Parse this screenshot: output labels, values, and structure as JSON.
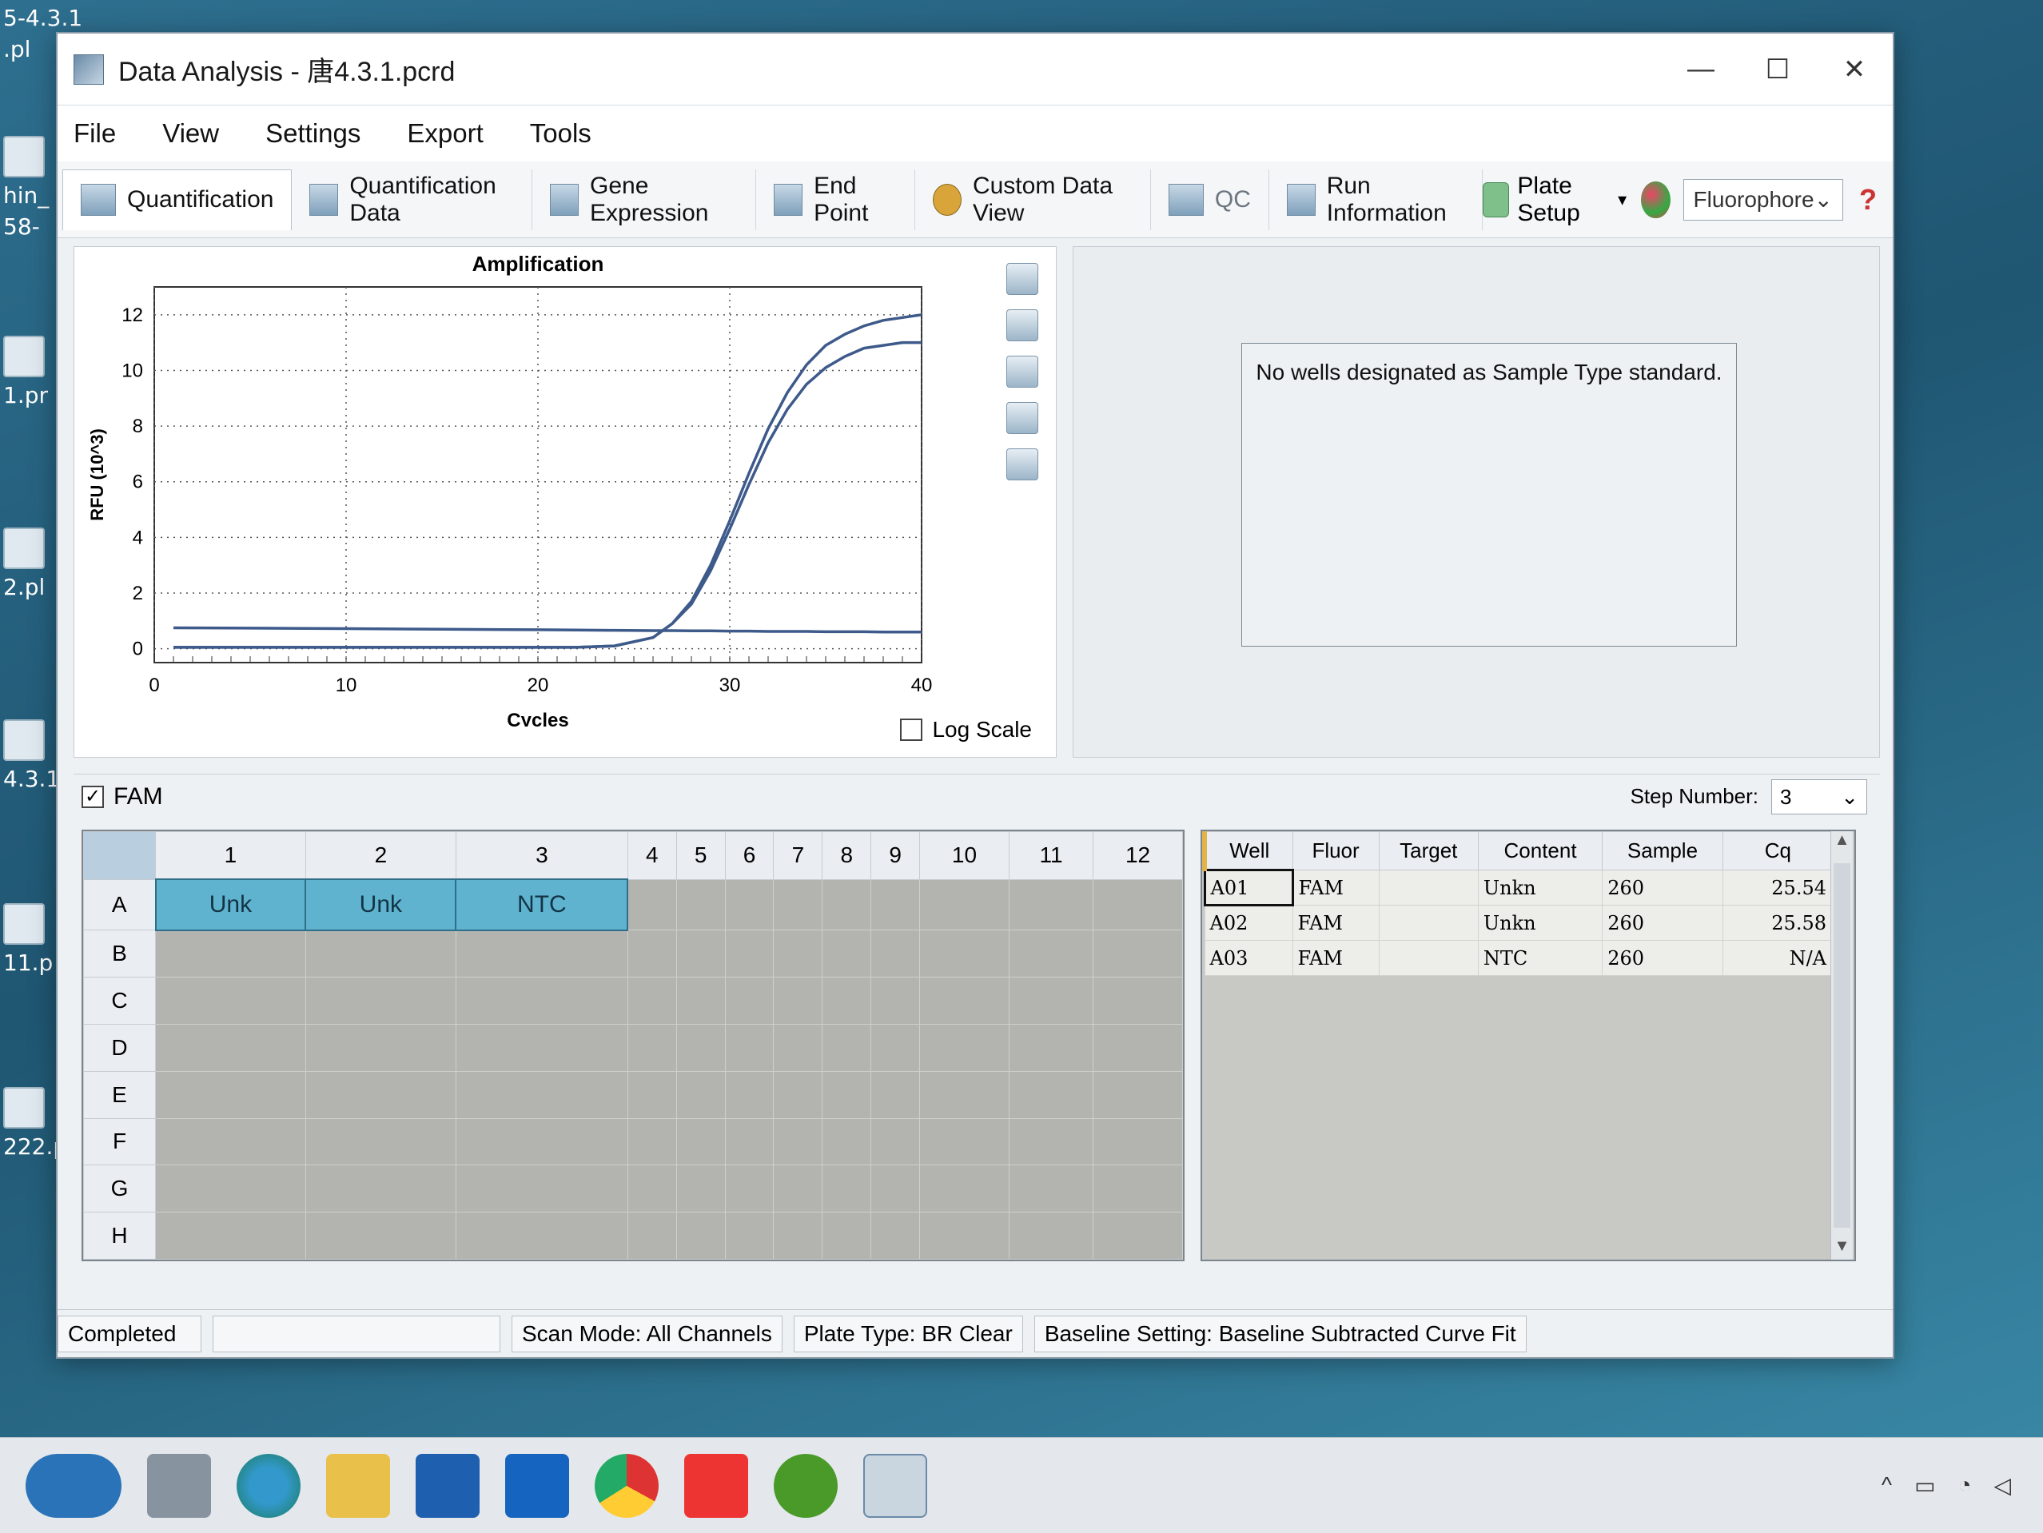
{
  "window": {
    "title": "Data Analysis - 唐4.3.1.pcrd",
    "controls": [
      "—",
      "☐",
      "✕"
    ]
  },
  "desktop_icons": [
    {
      "label": "5-4.3.1"
    },
    {
      "label": ".pl"
    },
    {
      "label": "hin_"
    },
    {
      "label": "58-"
    },
    {
      "label": "1.pr"
    },
    {
      "label": "2.pl"
    },
    {
      "label": "4.3.1"
    },
    {
      "label": "11.p"
    },
    {
      "label": "222.p"
    }
  ],
  "menu": [
    "File",
    "View",
    "Settings",
    "Export",
    "Tools"
  ],
  "tabs": [
    {
      "label": "Quantification",
      "icon": "amplification-icon"
    },
    {
      "label": "Quantification Data",
      "icon": "data-sheet-icon"
    },
    {
      "label": "Gene Expression",
      "icon": "bar-chart-icon"
    },
    {
      "label": "End Point",
      "icon": "endpoint-icon"
    },
    {
      "label": "Custom Data View",
      "icon": "gear-icon"
    },
    {
      "label": "QC",
      "icon": "qc-icon"
    },
    {
      "label": "Run Information",
      "icon": "document-icon"
    }
  ],
  "toolbar_right": {
    "plate_setup": "Plate Setup",
    "fluorophore": "Fluorophore",
    "help": "?"
  },
  "amplification": {
    "log_scale_label": "Log Scale"
  },
  "chart_data": {
    "type": "line",
    "title": "Amplification",
    "xlabel": "Cycles",
    "ylabel": "RFU (10^3)",
    "xlim": [
      0,
      40
    ],
    "ylim": [
      -0.5,
      13
    ],
    "x_ticks": [
      0,
      10,
      20,
      30,
      40
    ],
    "y_ticks": [
      0,
      2,
      4,
      6,
      8,
      10,
      12
    ],
    "grid": true,
    "x": [
      1,
      5,
      10,
      15,
      20,
      22,
      24,
      26,
      27,
      28,
      29,
      30,
      31,
      32,
      33,
      34,
      35,
      36,
      37,
      38,
      39,
      40
    ],
    "series": [
      {
        "values": [
          0.05,
          0.05,
          0.05,
          0.05,
          0.05,
          0.05,
          0.1,
          0.4,
          0.9,
          1.7,
          3.0,
          4.6,
          6.3,
          7.9,
          9.2,
          10.2,
          10.9,
          11.3,
          11.6,
          11.8,
          11.9,
          12.0
        ]
      },
      {
        "values": [
          0.05,
          0.05,
          0.05,
          0.05,
          0.05,
          0.05,
          0.1,
          0.4,
          0.9,
          1.6,
          2.8,
          4.3,
          5.9,
          7.4,
          8.6,
          9.5,
          10.1,
          10.5,
          10.8,
          10.9,
          11.0,
          11.0
        ]
      },
      {
        "values": [
          0.75,
          0.74,
          0.72,
          0.7,
          0.68,
          0.67,
          0.66,
          0.65,
          0.65,
          0.64,
          0.64,
          0.63,
          0.63,
          0.62,
          0.62,
          0.62,
          0.61,
          0.61,
          0.61,
          0.6,
          0.6,
          0.6
        ]
      }
    ]
  },
  "standard_curve": {
    "message": "No wells designated as Sample Type standard."
  },
  "fam_label": "FAM",
  "step_number": {
    "label": "Step Number:",
    "value": "3"
  },
  "plate": {
    "columns": [
      "1",
      "2",
      "3",
      "4",
      "5",
      "6",
      "7",
      "8",
      "9",
      "10",
      "11",
      "12"
    ],
    "rows": [
      "A",
      "B",
      "C",
      "D",
      "E",
      "F",
      "G",
      "H"
    ],
    "filled": {
      "A1": "Unk",
      "A2": "Unk",
      "A3": "NTC"
    }
  },
  "well_table": {
    "headers": [
      "Well",
      "Fluor",
      "Target",
      "Content",
      "Sample",
      "Cq"
    ],
    "rows": [
      {
        "well": "A01",
        "fluor": "FAM",
        "target": "",
        "content": "Unkn",
        "sample": "260",
        "cq": "25.54"
      },
      {
        "well": "A02",
        "fluor": "FAM",
        "target": "",
        "content": "Unkn",
        "sample": "260",
        "cq": "25.58"
      },
      {
        "well": "A03",
        "fluor": "FAM",
        "target": "",
        "content": "NTC",
        "sample": "260",
        "cq": "N/A"
      }
    ]
  },
  "status": {
    "state": "Completed",
    "scan_mode": "Scan Mode: All Channels",
    "plate_type": "Plate Type: BR Clear",
    "baseline": "Baseline Setting: Baseline Subtracted Curve Fit"
  },
  "colors": {
    "curve": "#3d5a8a",
    "filled_well": "#5fb3cf",
    "plate_bg": "#b3b3b0"
  },
  "taskbar_icons": [
    "dolphin-icon",
    "task-view-icon",
    "edge-icon",
    "folder-icon",
    "store-icon",
    "outlook-icon",
    "chrome-icon",
    "wps-icon",
    "ie-icon",
    "cfx-app-icon"
  ]
}
